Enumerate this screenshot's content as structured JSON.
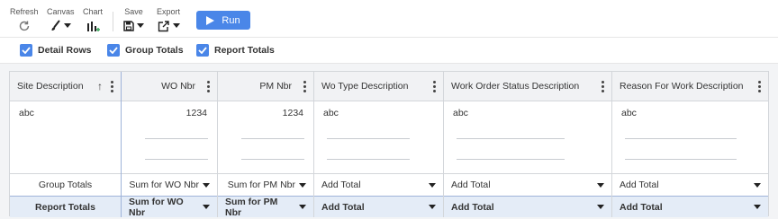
{
  "toolbar": {
    "refresh_label": "Refresh",
    "canvas_label": "Canvas",
    "chart_label": "Chart",
    "save_label": "Save",
    "export_label": "Export",
    "run_label": "Run",
    "icons": [
      "refresh-icon",
      "brush-icon",
      "bar-chart-icon",
      "floppy-icon",
      "export-icon",
      "play-icon"
    ]
  },
  "options": {
    "detail_rows": {
      "label": "Detail Rows",
      "checked": true
    },
    "group_totals": {
      "label": "Group Totals",
      "checked": true
    },
    "report_totals": {
      "label": "Report Totals",
      "checked": true
    }
  },
  "grid": {
    "columns": [
      {
        "header": "Site Description",
        "value": "abc"
      },
      {
        "header": "WO Nbr",
        "value": "1234"
      },
      {
        "header": "PM Nbr",
        "value": "1234"
      },
      {
        "header": "Wo Type Description",
        "value": "abc"
      },
      {
        "header": "Work Order Status Description",
        "value": "abc"
      },
      {
        "header": "Reason For Work Description",
        "value": "abc"
      }
    ],
    "group_totals": {
      "label": "Group Totals",
      "selects": [
        "Sum for WO Nbr",
        "Sum for PM Nbr",
        "Add Total",
        "Add Total",
        "Add Total"
      ]
    },
    "report_totals": {
      "label": "Report Totals",
      "selects": [
        "Sum for WO Nbr",
        "Sum for PM Nbr",
        "Add Total",
        "Add Total",
        "Add Total"
      ]
    }
  },
  "colors": {
    "accent": "#4a86e8",
    "report_totals_bg": "#e4ecf7",
    "header_bg": "#f1f2f4"
  }
}
